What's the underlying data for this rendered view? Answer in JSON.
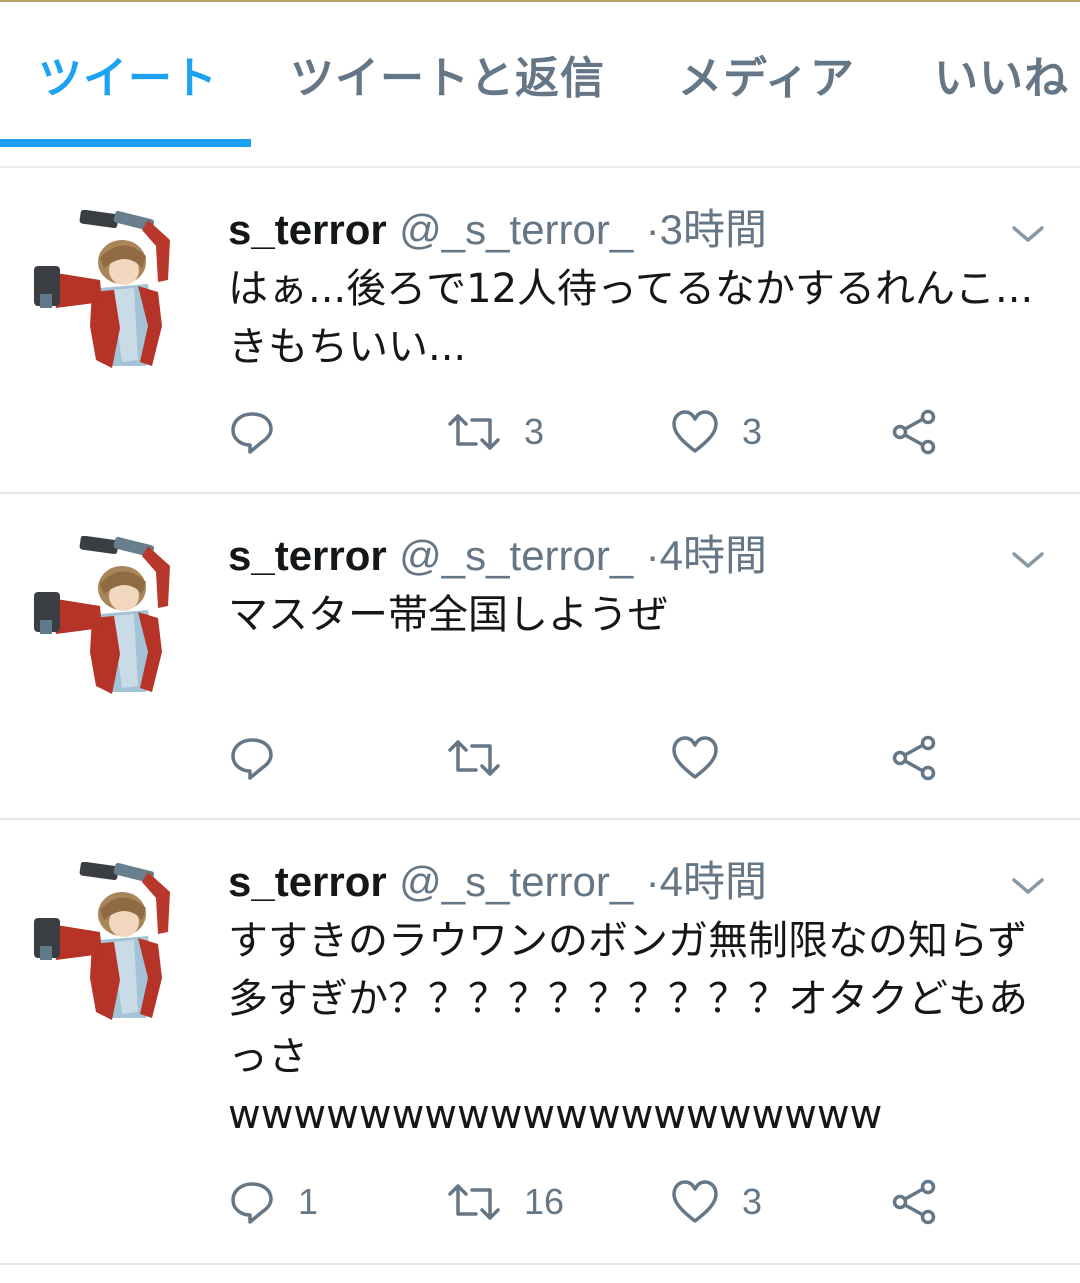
{
  "tabs": [
    {
      "label": "ツイート",
      "active": true
    },
    {
      "label": "ツイートと返信",
      "active": false
    },
    {
      "label": "メディア",
      "active": false
    },
    {
      "label": "いいね",
      "active": false
    }
  ],
  "colors": {
    "accent": "#1da1f2",
    "muted": "#657786",
    "text": "#14171a",
    "divider": "#e1e8ed"
  },
  "tweets": [
    {
      "name": "s_terror",
      "handle": "@_s_terror_",
      "dot": "·",
      "time": "3時間",
      "text": "はぁ...後ろで12人待ってるなかするれんこ...きもちいい...",
      "replies": "",
      "retweets": "3",
      "likes": "3"
    },
    {
      "name": "s_terror",
      "handle": "@_s_terror_",
      "dot": "·",
      "time": "4時間",
      "text": "マスター帯全国しようぜ",
      "replies": "",
      "retweets": "",
      "likes": ""
    },
    {
      "name": "s_terror",
      "handle": "@_s_terror_",
      "dot": "·",
      "time": "4時間",
      "text": "すすきのラウワンのボンガ無制限なの知らず多すぎか？？？？？？？？？？オタクどもあっさ\nwwwwwwwwwwwwwwwwwwww",
      "replies": "1",
      "retweets": "16",
      "likes": "3"
    }
  ],
  "icons": {
    "reply": "reply-icon",
    "retweet": "retweet-icon",
    "like": "heart-icon",
    "share": "share-icon",
    "caret": "chevron-down-icon"
  }
}
